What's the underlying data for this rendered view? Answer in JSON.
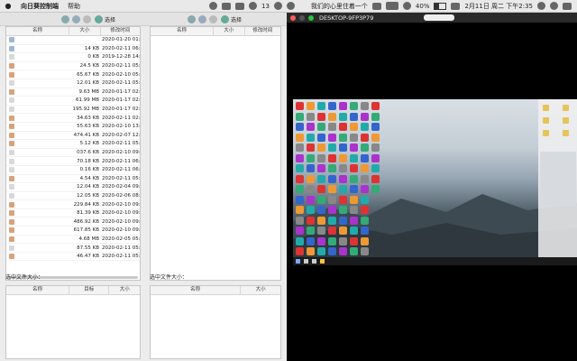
{
  "menubar": {
    "app_name": "向日葵控制端",
    "help": "帮助",
    "notification_count": "13",
    "status_text": "我们的心里住着一个",
    "battery": "40%",
    "battery_level": 0.4,
    "datetime": "2月11日 周二 下午2:35"
  },
  "toolbar": {
    "left_select": "选择",
    "right_select": "选择"
  },
  "local_panel": {
    "headers": [
      "名称",
      "大小",
      "修改时间"
    ],
    "rows": [
      {
        "icon": "folder",
        "name": "",
        "size": "",
        "modified": "2020-01-20 01:5"
      },
      {
        "icon": "folder",
        "name": "",
        "size": "14 KB",
        "modified": "2020-02-11 06:3"
      },
      {
        "icon": "doc",
        "name": "",
        "size": "0 KB",
        "modified": "2019-12-28 14:5"
      },
      {
        "icon": "img",
        "name": "",
        "size": "24.5 KB",
        "modified": "2020-02-11 05:3"
      },
      {
        "icon": "img",
        "name": "",
        "size": "65.67 KB",
        "modified": "2020-02-10 05:5"
      },
      {
        "icon": "doc",
        "name": "",
        "size": "12.01 KB",
        "modified": "2020-02-11 05:3"
      },
      {
        "icon": "img",
        "name": "",
        "size": "9.63 MB",
        "modified": "2020-01-17 02:1"
      },
      {
        "icon": "doc",
        "name": "",
        "size": "61.99 MB",
        "modified": "2020-01-17 02:1"
      },
      {
        "icon": "doc",
        "name": "",
        "size": "195.92 MB",
        "modified": "2020-01-17 02:3"
      },
      {
        "icon": "img",
        "name": "",
        "size": "34.63 KB",
        "modified": "2020-02-11 02:3"
      },
      {
        "icon": "img",
        "name": "",
        "size": "55.63 KB",
        "modified": "2020-02-10 13:3"
      },
      {
        "icon": "img",
        "name": "",
        "size": "474.41 KB",
        "modified": "2020-02-07 12:3"
      },
      {
        "icon": "img",
        "name": "",
        "size": "5.12 KB",
        "modified": "2020-02-11 05:1"
      },
      {
        "icon": "doc",
        "name": "",
        "size": "037.6 KB",
        "modified": "2020-02-10 09:5"
      },
      {
        "icon": "doc",
        "name": "",
        "size": "70.18 KB",
        "modified": "2020-02-11 06:2"
      },
      {
        "icon": "doc",
        "name": "",
        "size": "0.16 KB",
        "modified": "2020-02-11 06:3"
      },
      {
        "icon": "img",
        "name": "",
        "size": "4.54 KB",
        "modified": "2020-02-11 05:1"
      },
      {
        "icon": "doc",
        "name": "",
        "size": "12.04 KB",
        "modified": "2020-02-04 09:1"
      },
      {
        "icon": "doc",
        "name": "",
        "size": "12.05 KB",
        "modified": "2020-02-06 08:3"
      },
      {
        "icon": "img",
        "name": "",
        "size": "229.84 KB",
        "modified": "2020-02-10 09:5"
      },
      {
        "icon": "img",
        "name": "",
        "size": "81.39 KB",
        "modified": "2020-02-10 09:5"
      },
      {
        "icon": "img",
        "name": "",
        "size": "486.92 KB",
        "modified": "2020-02-10 09:5"
      },
      {
        "icon": "img",
        "name": "",
        "size": "617.85 KB",
        "modified": "2020-02-10 09:5"
      },
      {
        "icon": "img",
        "name": "",
        "size": "4.68 MB",
        "modified": "2020-02-05 05:3"
      },
      {
        "icon": "doc",
        "name": "",
        "size": "87.55 KB",
        "modified": "2020-02-11 05:4"
      },
      {
        "icon": "img",
        "name": "",
        "size": "46.47 KB",
        "modified": "2020-02-11 05:2"
      }
    ]
  },
  "remote_panel": {
    "headers": [
      "名称",
      "大小",
      "修改时间"
    ]
  },
  "selected_label_left": "选中文件大小：",
  "selected_label_right": "选中文件大小：",
  "transfer_left_headers": [
    "名称",
    "目标",
    "大小"
  ],
  "transfer_right_headers": [
    "名称",
    "大小"
  ],
  "remote_window": {
    "title": "DESKTOP-9FP3P79"
  }
}
